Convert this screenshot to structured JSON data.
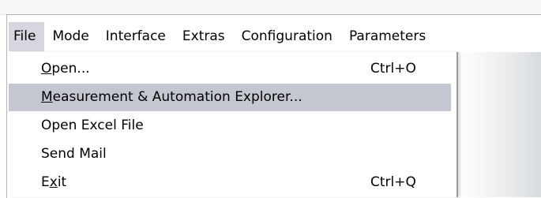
{
  "menubar": {
    "items": [
      {
        "label": "File",
        "active": true
      },
      {
        "label": "Mode"
      },
      {
        "label": "Interface"
      },
      {
        "label": "Extras"
      },
      {
        "label": "Configuration"
      },
      {
        "label": "Parameters"
      }
    ]
  },
  "file_menu": {
    "items": [
      {
        "pre": "",
        "mnemonic": "O",
        "post": "pen...",
        "shortcut": "Ctrl+O"
      },
      {
        "pre": "",
        "mnemonic": "M",
        "post": "easurement & Automation Explorer...",
        "shortcut": "",
        "highlighted": true
      },
      {
        "pre": "Open Excel File",
        "mnemonic": "",
        "post": "",
        "shortcut": ""
      },
      {
        "pre": "Send Mail",
        "mnemonic": "",
        "post": "",
        "shortcut": ""
      },
      {
        "pre": "E",
        "mnemonic": "x",
        "post": "it",
        "shortcut": "Ctrl+Q"
      }
    ]
  },
  "colors": {
    "menu_active_bg": "#d6d6de",
    "item_highlight_bg": "#c4c6d0",
    "dropdown_border": "#9a9a9a"
  }
}
